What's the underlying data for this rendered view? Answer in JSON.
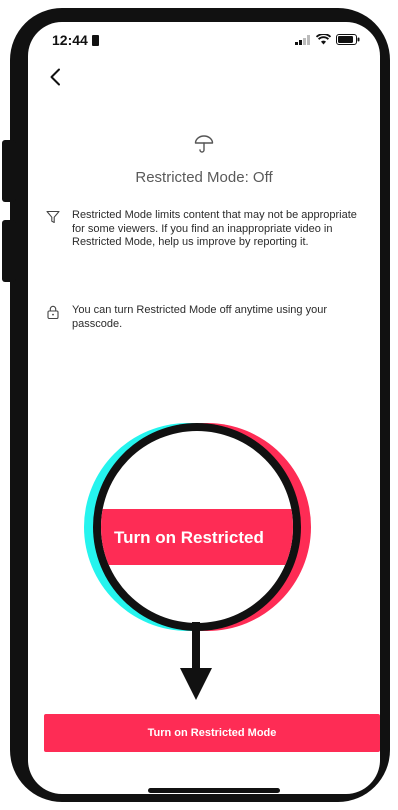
{
  "status_bar": {
    "time": "12:44"
  },
  "page": {
    "title": "Restricted Mode: Off",
    "info": [
      {
        "icon": "filter-icon",
        "text": "Restricted Mode limits content that may not be appropriate for some viewers. If you find an inappropriate video in Restricted Mode, help us improve by reporting it."
      },
      {
        "icon": "lock-icon",
        "text": "You can turn Restricted Mode  off anytime using your passcode."
      }
    ],
    "cta_label": "Turn on Restricted Mode"
  },
  "callout": {
    "zoom_label": "Turn on Restricted"
  },
  "colors": {
    "accent": "#fe2c55",
    "cyan": "#25f4ee",
    "frame": "#111111"
  }
}
